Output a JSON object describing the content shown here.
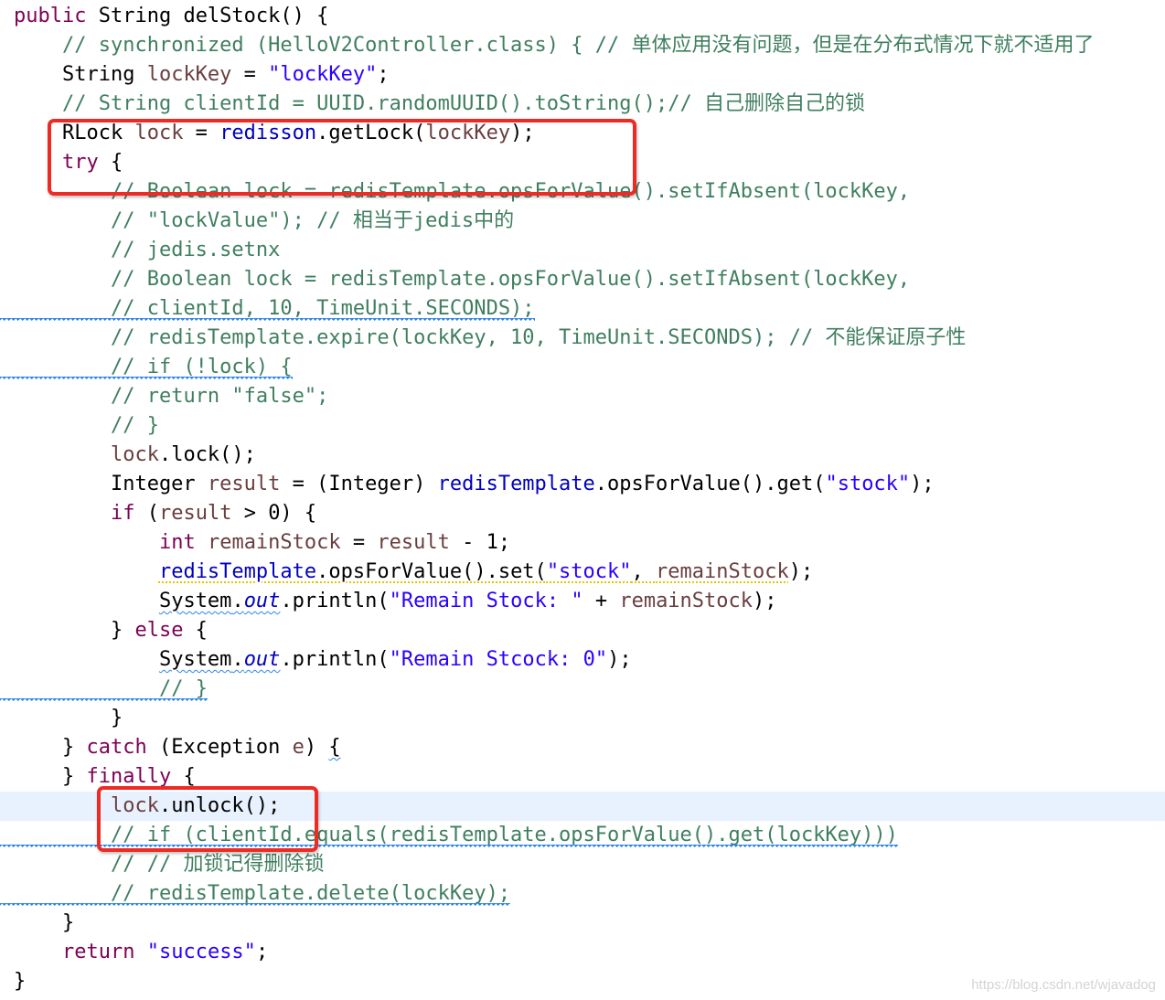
{
  "editor": {
    "language": "java",
    "colors": {
      "keyword": "#7f0055",
      "comment": "#3f7f5f",
      "string": "#2a00ff",
      "field": "#0000c0",
      "local_variable": "#6a3e3e",
      "current_line": "#e8f2fe",
      "annotation_box": "#ee2a24"
    },
    "lines": [
      {
        "t": [
          [
            "k",
            "public"
          ],
          [
            "p",
            " String delStock() {"
          ]
        ]
      },
      {
        "t": [
          [
            "p",
            "    "
          ],
          [
            "c",
            "// synchronized (HelloV2Controller.class) { // 单体应用没有问题，但是在分布式情况下就不适用了"
          ]
        ]
      },
      {
        "t": [
          [
            "p",
            "    String "
          ],
          [
            "v",
            "lockKey"
          ],
          [
            "p",
            " = "
          ],
          [
            "s",
            "\"lockKey\""
          ],
          [
            "p",
            ";"
          ]
        ]
      },
      {
        "t": [
          [
            "p",
            "    "
          ],
          [
            "c",
            "// String clientId = UUID.randomUUID().toString();// 自己删除自己的锁"
          ]
        ]
      },
      {
        "t": [
          [
            "p",
            "    RLock "
          ],
          [
            "v",
            "lock"
          ],
          [
            "p",
            " = "
          ],
          [
            "f",
            "redisson"
          ],
          [
            "p",
            ".getLock("
          ],
          [
            "v",
            "lockKey"
          ],
          [
            "p",
            ");"
          ]
        ]
      },
      {
        "t": [
          [
            "p",
            "    "
          ],
          [
            "k",
            "try"
          ],
          [
            "p",
            " {"
          ]
        ]
      },
      {
        "t": [
          [
            "p",
            "        "
          ],
          [
            "c",
            "// Boolean lock = redisTemplate.opsForValue().setIfAbsent(lockKey,"
          ]
        ]
      },
      {
        "t": [
          [
            "p",
            "        "
          ],
          [
            "c",
            "// \"lockValue\"); // 相当于jedis中的"
          ]
        ]
      },
      {
        "t": [
          [
            "p",
            "        "
          ],
          [
            "c",
            "// jedis.setnx"
          ]
        ]
      },
      {
        "t": [
          [
            "p",
            "        "
          ],
          [
            "c",
            "// Boolean lock = redisTemplate.opsForValue().setIfAbsent(lockKey,"
          ]
        ]
      },
      {
        "t": [
          [
            "p",
            "        "
          ],
          [
            "c",
            "// clientId, 10, TimeUnit.SECONDS);"
          ]
        ],
        "warning": true
      },
      {
        "t": [
          [
            "p",
            "        "
          ],
          [
            "c",
            "// redisTemplate.expire(lockKey, 10, TimeUnit.SECONDS); // 不能保证原子性"
          ]
        ]
      },
      {
        "t": [
          [
            "p",
            "        "
          ],
          [
            "c",
            "// if (!lock) {"
          ]
        ],
        "warning": true
      },
      {
        "t": [
          [
            "p",
            "        "
          ],
          [
            "c",
            "// return \"false\";"
          ]
        ]
      },
      {
        "t": [
          [
            "p",
            "        "
          ],
          [
            "c",
            "// }"
          ]
        ]
      },
      {
        "t": [
          [
            "p",
            "        "
          ],
          [
            "v",
            "lock"
          ],
          [
            "p",
            ".lock();"
          ]
        ]
      },
      {
        "t": [
          [
            "p",
            "        Integer "
          ],
          [
            "v",
            "result"
          ],
          [
            "p",
            " = (Integer) "
          ],
          [
            "f",
            "redisTemplate"
          ],
          [
            "p",
            ".opsForValue().get("
          ],
          [
            "s",
            "\"stock\""
          ],
          [
            "p",
            ");"
          ]
        ]
      },
      {
        "t": [
          [
            "p",
            "        "
          ],
          [
            "k",
            "if"
          ],
          [
            "p",
            " ("
          ],
          [
            "v",
            "result"
          ],
          [
            "p",
            " > 0) {"
          ]
        ]
      },
      {
        "t": [
          [
            "p",
            "            "
          ],
          [
            "k",
            "int"
          ],
          [
            "p",
            " "
          ],
          [
            "v",
            "remainStock"
          ],
          [
            "p",
            " = "
          ],
          [
            "v",
            "result"
          ],
          [
            "p",
            " - 1;"
          ]
        ]
      },
      {
        "t": [
          [
            "p",
            "            "
          ],
          [
            "f",
            "redisTemplate",
            "y"
          ],
          [
            "p",
            ".opsForValue().set(",
            "y"
          ],
          [
            "s",
            "\"stock\"",
            "y"
          ],
          [
            "p",
            ", ",
            "y"
          ],
          [
            "v",
            "remainStock",
            "y"
          ],
          [
            "p",
            ");"
          ]
        ]
      },
      {
        "t": [
          [
            "p",
            "            "
          ],
          [
            "p",
            "System",
            "w"
          ],
          [
            "p",
            ".",
            "w"
          ],
          [
            "i",
            "out",
            "w"
          ],
          [
            "p",
            ".println("
          ],
          [
            "s",
            "\"Remain Stock: \""
          ],
          [
            "p",
            " + "
          ],
          [
            "v",
            "remainStock"
          ],
          [
            "p",
            ");"
          ]
        ]
      },
      {
        "t": [
          [
            "p",
            "        } "
          ],
          [
            "k",
            "else"
          ],
          [
            "p",
            " {"
          ]
        ]
      },
      {
        "t": [
          [
            "p",
            "            "
          ],
          [
            "p",
            "System",
            "w"
          ],
          [
            "p",
            ".",
            "w"
          ],
          [
            "i",
            "out",
            "w"
          ],
          [
            "p",
            ".println("
          ],
          [
            "s",
            "\"Remain Stcock: 0\""
          ],
          [
            "p",
            ");"
          ]
        ]
      },
      {
        "t": [
          [
            "p",
            "            "
          ],
          [
            "c",
            "// }"
          ]
        ],
        "warning": true
      },
      {
        "t": [
          [
            "p",
            "        }"
          ]
        ]
      },
      {
        "t": [
          [
            "p",
            "    } "
          ],
          [
            "k",
            "catch"
          ],
          [
            "p",
            " (Exception "
          ],
          [
            "v",
            "e"
          ],
          [
            "p",
            ") "
          ],
          [
            "p",
            "{",
            "w"
          ]
        ]
      },
      {
        "t": [
          [
            "p",
            "    } "
          ],
          [
            "k",
            "finally"
          ],
          [
            "p",
            " {"
          ]
        ]
      },
      {
        "t": [
          [
            "p",
            "        "
          ],
          [
            "v",
            "lock"
          ],
          [
            "p",
            ".unlock();"
          ]
        ],
        "current": true
      },
      {
        "t": [
          [
            "p",
            "        "
          ],
          [
            "c",
            "// if (clientId.equals(redisTemplate.opsForValue().get(lockKey)))"
          ]
        ],
        "warning": true
      },
      {
        "t": [
          [
            "p",
            "        "
          ],
          [
            "c",
            "// // 加锁记得删除锁"
          ]
        ]
      },
      {
        "t": [
          [
            "p",
            "        "
          ],
          [
            "c",
            "// redisTemplate.delete(lockKey);"
          ]
        ],
        "warning": true
      },
      {
        "t": [
          [
            "p",
            "    }"
          ]
        ]
      },
      {
        "t": [
          [
            "p",
            "    "
          ],
          [
            "k",
            "return"
          ],
          [
            "p",
            " "
          ],
          [
            "s",
            "\"success\""
          ],
          [
            "p",
            ";"
          ]
        ]
      },
      {
        "t": [
          [
            "p",
            "}"
          ]
        ]
      }
    ]
  },
  "watermark": "https://blog.csdn.net/wjavadog"
}
